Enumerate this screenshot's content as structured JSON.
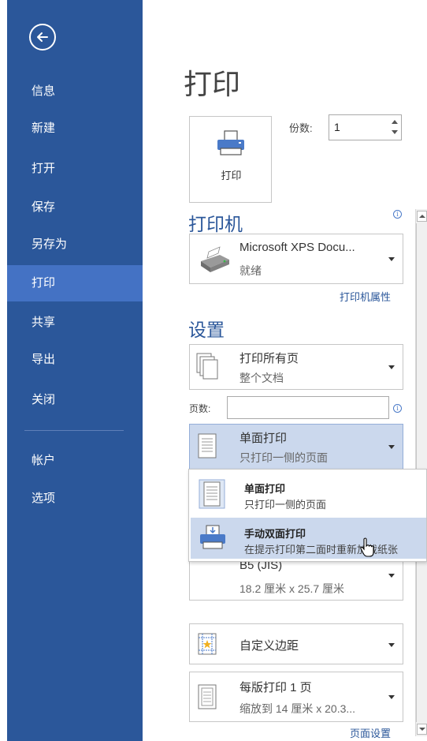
{
  "sidebar": {
    "items": [
      {
        "label": "信息"
      },
      {
        "label": "新建"
      },
      {
        "label": "打开"
      },
      {
        "label": "保存"
      },
      {
        "label": "另存为"
      },
      {
        "label": "打印"
      },
      {
        "label": "共享"
      },
      {
        "label": "导出"
      },
      {
        "label": "关闭"
      },
      {
        "label": "帐户"
      },
      {
        "label": "选项"
      }
    ],
    "active": "打印"
  },
  "main": {
    "title": "打印",
    "print_button_label": "打印",
    "copies_label": "份数:",
    "copies_value": "1",
    "printer_section_title": "打印机",
    "printer": {
      "name": "Microsoft XPS Docu...",
      "status": "就绪"
    },
    "printer_properties_link": "打印机属性",
    "settings_section_title": "设置",
    "settings": {
      "range": {
        "main": "打印所有页",
        "sub": "整个文档"
      },
      "pages_label": "页数:",
      "pages_value": "",
      "sides": {
        "main": "单面打印",
        "sub": "只打印一侧的页面"
      },
      "paper": {
        "main": "B5 (JIS)",
        "sub": "18.2 厘米 x 25.7 厘米"
      },
      "margins": {
        "main": "自定义边距"
      },
      "per_sheet": {
        "main": "每版打印 1 页",
        "sub": "缩放到 14 厘米 x 20.3..."
      }
    },
    "page_setup_link": "页面设置"
  },
  "popup": {
    "items": [
      {
        "main": "单面打印",
        "sub": "只打印一侧的页面"
      },
      {
        "main": "手动双面打印",
        "sub": "在提示打印第二面时重新加载纸张"
      }
    ]
  },
  "colors": {
    "sidebar_bg": "#2b579a",
    "sidebar_active": "#4472c4",
    "accent_text": "#2b579a",
    "selected_bg": "#cbd8ed"
  }
}
